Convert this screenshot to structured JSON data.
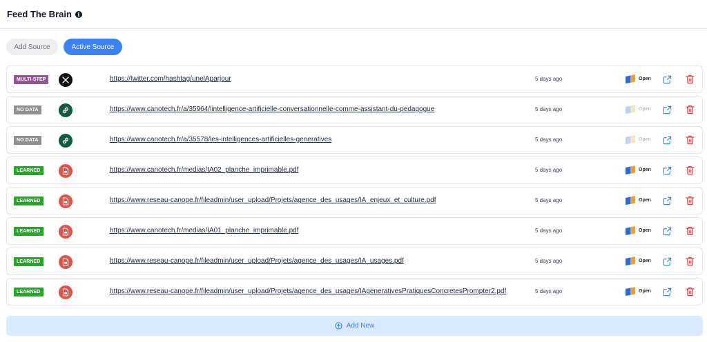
{
  "header": {
    "title": "Feed The Brain",
    "info_icon": "info-icon"
  },
  "tabs": [
    {
      "label": "Add Source",
      "active": false
    },
    {
      "label": "Active Source",
      "active": true
    }
  ],
  "colors": {
    "multi_step": "#9b4f96",
    "no_data": "#8f8f8f",
    "learned": "#22a822",
    "accent": "#3b82f6",
    "danger": "#ef4444",
    "link_icon_bg": "#0d5c3f",
    "pdf_icon_bg": "#e0524a"
  },
  "sources": [
    {
      "status": "MULTI-STEP",
      "status_key": "multi_step",
      "icon": "x-logo-icon",
      "url": "https://twitter.com/hashtag/unelAparjour",
      "date": "5 days ago",
      "open_label": "Open",
      "open_enabled": true
    },
    {
      "status": "NO DATA",
      "status_key": "no_data",
      "icon": "link-icon",
      "url": "https://www.canotech.fr/a/35964/lintelligence-artificielle-conversationnelle-comme-assistant-du-pedagogue",
      "date": "5 days ago",
      "open_label": "Open",
      "open_enabled": false
    },
    {
      "status": "NO DATA",
      "status_key": "no_data",
      "icon": "link-icon",
      "url": "https://www.canotech.fr/a/35578/les-intelligences-artificielles-generatives",
      "date": "5 days ago",
      "open_label": "Open",
      "open_enabled": false
    },
    {
      "status": "LEARNED",
      "status_key": "learned",
      "icon": "pdf-file-icon",
      "url": "https://www.canotech.fr/medias/IA02_planche_imprimable.pdf",
      "date": "5 days ago",
      "open_label": "Open",
      "open_enabled": true
    },
    {
      "status": "LEARNED",
      "status_key": "learned",
      "icon": "pdf-file-icon",
      "url": "https://www.reseau-canope.fr/fileadmin/user_upload/Projets/agence_des_usages/IA_enjeux_et_culture.pdf",
      "date": "5 days ago",
      "open_label": "Open",
      "open_enabled": true
    },
    {
      "status": "LEARNED",
      "status_key": "learned",
      "icon": "pdf-file-icon",
      "url": "https://www.canotech.fr/medias/IA01_planche_imprimable.pdf",
      "date": "5 days ago",
      "open_label": "Open",
      "open_enabled": true
    },
    {
      "status": "LEARNED",
      "status_key": "learned",
      "icon": "pdf-file-icon",
      "url": "https://www.reseau-canope.fr/fileadmin/user_upload/Projets/agence_des_usages/IA_usages.pdf",
      "date": "5 days ago",
      "open_label": "Open",
      "open_enabled": true
    },
    {
      "status": "LEARNED",
      "status_key": "learned",
      "icon": "pdf-file-icon",
      "url": "https://www.reseau-canope.fr/fileadmin/user_upload/Projets/agence_des_usages/IAgenerativesPratiquesConcretesPrompter2.pdf",
      "date": "5 days ago",
      "open_label": "Open",
      "open_enabled": true
    }
  ],
  "add_new": {
    "label": "Add New",
    "icon": "plus-circle-icon"
  }
}
